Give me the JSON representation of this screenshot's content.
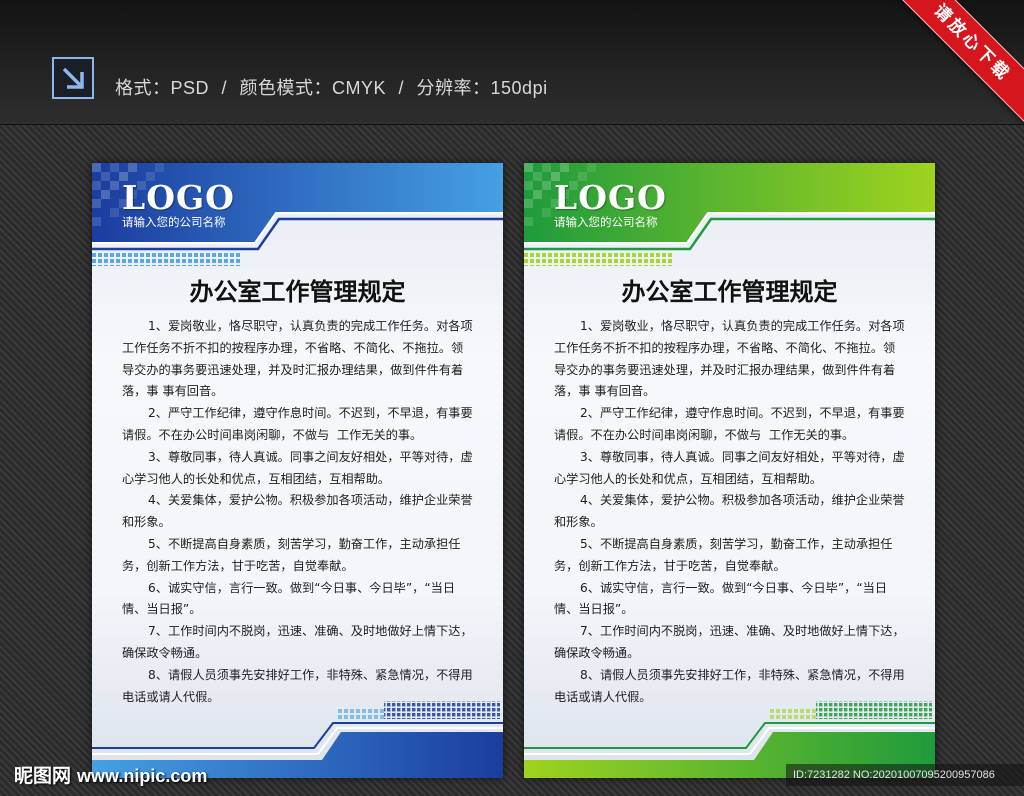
{
  "header": {
    "icon": "arrow-down-right-icon",
    "info_text": "格式：PSD / 颜色模式：CMYK / 分辨率：150dpi"
  },
  "ribbon": {
    "text": "请放心下载",
    "color": "#d6161d"
  },
  "poster_content": {
    "logo": "LOGO",
    "company_name": "请输入您的公司名称",
    "title": "办公室工作管理规定",
    "rules": [
      {
        "lines": [
          "1、爱岗敬业，恪尽职守，认真负责的完成工作任务。对各项",
          "工作任务不折不扣的按程序办理，不省略、不简化、不拖拉。领",
          "导交办的事务要迅速处理，并及时汇报办理结果，做到件件有着",
          "落，事 事有回音。"
        ]
      },
      {
        "lines": [
          "2、严守工作纪律，遵守作息时间。不迟到，不早退，有事要",
          "请假。不在办公时间串岗闲聊，不做与  工作无关的事。"
        ]
      },
      {
        "lines": [
          "3、尊敬同事，待人真诚。同事之间友好相处，平等对待，虚",
          "心学习他人的长处和优点，互相团结，互相帮助。"
        ]
      },
      {
        "lines": [
          "4、关爱集体，爱护公物。积极参加各项活动，维护企业荣誉",
          "和形象。"
        ]
      },
      {
        "lines": [
          "5、不断提高自身素质，刻苦学习，勤奋工作，主动承担任",
          "务，创新工作方法，甘于吃苦，自觉奉献。"
        ]
      },
      {
        "lines": [
          "6、诚实守信，言行一致。做到“今日事、今日毕”，“当日",
          "情、当日报”。"
        ]
      },
      {
        "lines": [
          "7、工作时间内不脱岗，迅速、准确、及时地做好上情下达，",
          "确保政令畅通。"
        ]
      },
      {
        "lines": [
          "8、请假人员须事先安排好工作，非特殊、紧急情况，不得用",
          "电话或请人代假。"
        ]
      }
    ]
  },
  "themes": [
    {
      "dark": "#1b3d9f",
      "light": "#45a0e4"
    },
    {
      "dark": "#1f9b3c",
      "light": "#9fd31f"
    }
  ],
  "watermark": {
    "site_name": "昵图网",
    "url": "www.nipic.com"
  },
  "image_id": "ID:7231282 NO:20201007095200957086"
}
